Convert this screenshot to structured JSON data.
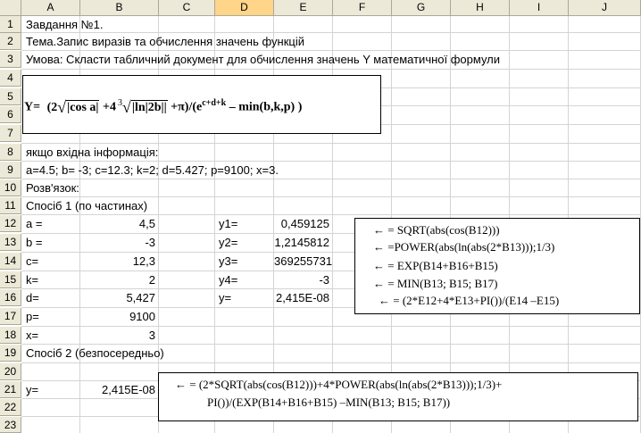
{
  "columns": [
    "A",
    "B",
    "C",
    "D",
    "E",
    "F",
    "G",
    "H",
    "I",
    "J"
  ],
  "rows": [
    "1",
    "2",
    "3",
    "4",
    "5",
    "6",
    "7",
    "8",
    "9",
    "10",
    "11",
    "12",
    "13",
    "14",
    "15",
    "16",
    "17",
    "18",
    "19",
    "20",
    "21",
    "22",
    "23"
  ],
  "text": {
    "r1": "Завдання №1.",
    "r2": "Тема.Запис виразів та обчислення значень функцій",
    "r3": "Умова: Скласти табличний документ для обчислення значень Y математичної формули",
    "r8": "якщо вхідна інформація:",
    "r9": "a=4.5; b= -3; c=12.3; k=2; d=5.427; p=9100; x=3.",
    "r10": "Розв'язок:",
    "r11": "Спосіб 1 (по частинах)",
    "r19": "Спосіб 2 (безпосередньо)"
  },
  "formula": {
    "y": "Y=",
    "p1": "(2",
    "sqrt1": "|cos a|",
    "plus4": "+4",
    "cube": "3",
    "sqrt2": "|ln|2b||",
    "pi": "+π)/(e",
    "exp": "c+d+k",
    "tail": "– min(b,k,p) )"
  },
  "inputs": [
    {
      "label": "a =",
      "value": "4,5"
    },
    {
      "label": "b =",
      "value": "-3"
    },
    {
      "label": "c=",
      "value": "12,3"
    },
    {
      "label": "k=",
      "value": "2"
    },
    {
      "label": "d=",
      "value": "5,427"
    },
    {
      "label": "p=",
      "value": "9100"
    },
    {
      "label": "x=",
      "value": "3"
    }
  ],
  "results": [
    {
      "label": "y1=",
      "value": "0,459125"
    },
    {
      "label": "y2=",
      "value": "1,2145812"
    },
    {
      "label": "y3=",
      "value": "369255731"
    },
    {
      "label": "y4=",
      "value": "-3"
    },
    {
      "label": "y=",
      "value": "2,415E-08"
    }
  ],
  "method1_formulas": [
    "←    = SQRT(abs(cos(B12)))",
    "←   =POWER(abs(ln(abs(2*B13)));1/3)",
    "←   = EXP(B14+B16+B15)",
    "←   = MIN(B13; B15; B17)",
    "←  = (2*E12+4*E13+PI())/(E14 –E15)"
  ],
  "method2": {
    "label": "y=",
    "value": "2,415E-08",
    "formula_line1": "←    =  (2*SQRT(abs(cos(B12)))+4*POWER(abs(ln(abs(2*B13)));1/3)+",
    "formula_line2": "PI())/(EXP(B14+B16+B15)  –MIN(B13; B15; B17))"
  },
  "colors": {
    "header_bg": "#ece9d8",
    "header_active": "#ffd58a",
    "grid": "#d4d4d4"
  }
}
